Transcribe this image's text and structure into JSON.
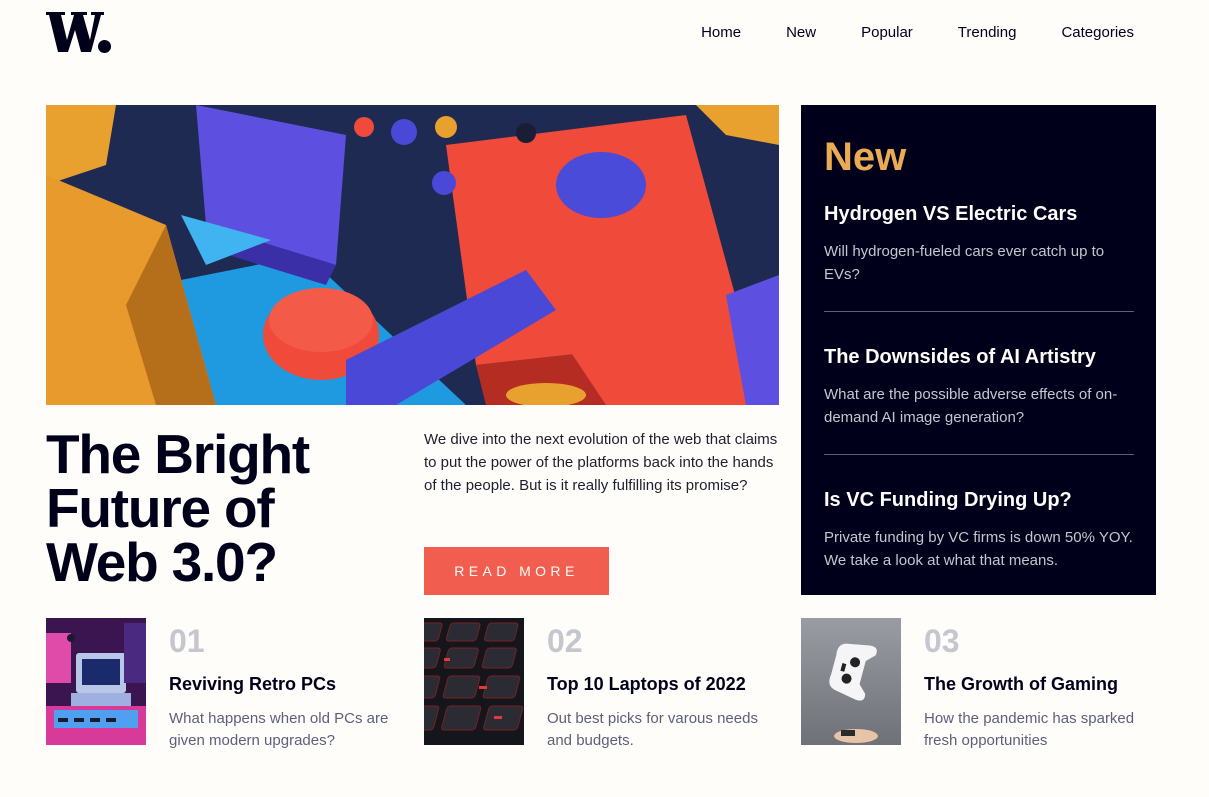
{
  "logo": {
    "text": "W."
  },
  "nav": {
    "items": [
      "Home",
      "New",
      "Popular",
      "Trending",
      "Categories"
    ]
  },
  "hero": {
    "title": "The Bright Future of Web 3.0?",
    "description": "We dive into the next evolution of the web that claims to put the power of the platforms back into the hands of the people. But is it really fulfilling its promise?",
    "button_label": "READ MORE"
  },
  "new_panel": {
    "heading": "New",
    "items": [
      {
        "title": "Hydrogen VS Electric Cars",
        "desc": "Will hydrogen-fueled cars ever catch up to EVs?"
      },
      {
        "title": "The Downsides of AI Artistry",
        "desc": "What are the possible adverse effects of on-demand AI image generation?"
      },
      {
        "title": "Is VC Funding Drying Up?",
        "desc": "Private funding by VC firms is down 50% YOY. We take a look at what that means."
      }
    ]
  },
  "cards": [
    {
      "number": "01",
      "title": "Reviving Retro PCs",
      "desc": "What happens when old PCs are given modern upgrades?"
    },
    {
      "number": "02",
      "title": "Top 10 Laptops of 2022",
      "desc": "Out best picks for varous needs and budgets."
    },
    {
      "number": "03",
      "title": "The Growth of Gaming",
      "desc": "How the pandemic has sparked fresh opportunities"
    }
  ],
  "colors": {
    "background": "#fffdfa",
    "dark_navy": "#00001a",
    "accent_red": "#f15e50",
    "accent_orange": "#e9ab53",
    "grayish_blue": "#5d5f79",
    "light_gray": "#c5c6ce"
  }
}
